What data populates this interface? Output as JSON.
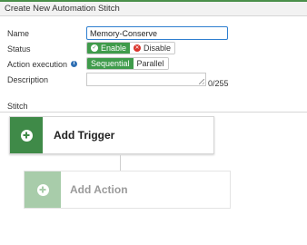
{
  "header": {
    "title": "Create New Automation Stitch"
  },
  "form": {
    "name": {
      "label": "Name",
      "value": "Memory-Conserve"
    },
    "status": {
      "label": "Status",
      "options": [
        "Enable",
        "Disable"
      ],
      "selected": "Enable"
    },
    "action_execution": {
      "label": "Action execution",
      "options": [
        "Sequential",
        "Parallel"
      ],
      "selected": "Sequential"
    },
    "description": {
      "label": "Description",
      "value": "",
      "counter": "0/255"
    }
  },
  "stitch": {
    "section_title": "Stitch",
    "trigger_label": "Add Trigger",
    "action_label": "Add Action"
  },
  "colors": {
    "accent": "#3f9b4b",
    "disabled_red": "#d9342b",
    "info_blue": "#2f6fb3"
  }
}
